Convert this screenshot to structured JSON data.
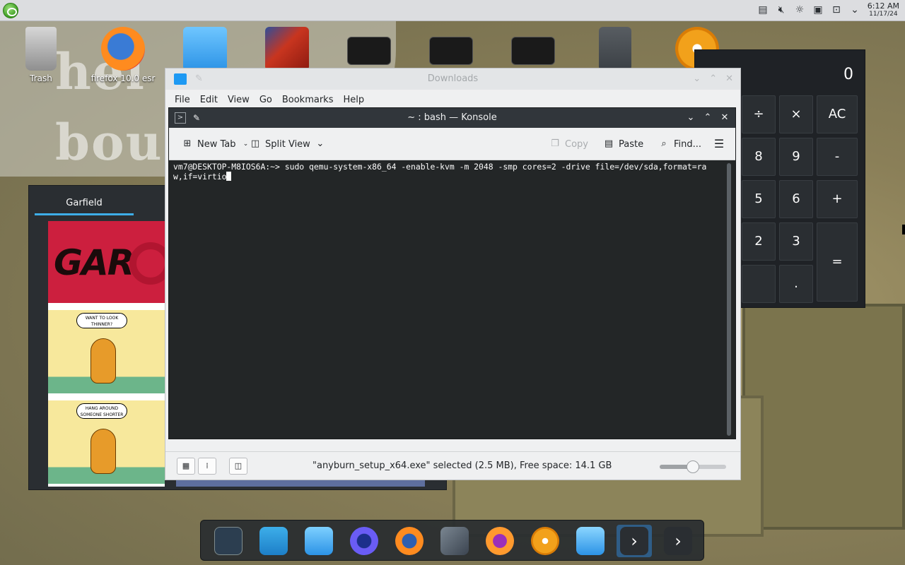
{
  "top_panel": {
    "clock_time": "6:12 AM",
    "clock_date": "11/17/24",
    "tray_icons": [
      "clipboard-icon",
      "volume-muted-icon",
      "brightness-icon",
      "storage-icon",
      "network-icon",
      "expand-tray-icon"
    ]
  },
  "desktop": {
    "icons": [
      {
        "label": "Trash",
        "icon": "trash-icon"
      },
      {
        "label": "firefox 10.0 esr",
        "icon": "firefox-icon"
      },
      {
        "label": "",
        "icon": "home-folder-icon"
      },
      {
        "label": "",
        "icon": "dinosaur-app-icon"
      },
      {
        "label": "",
        "icon": "vaio-image-icon"
      },
      {
        "label": "",
        "icon": "vaio-image-icon"
      },
      {
        "label": "",
        "icon": "vaio-image-icon"
      },
      {
        "label": "",
        "icon": "terminal-script-icon"
      },
      {
        "label": "",
        "icon": "disc-burner-icon"
      }
    ]
  },
  "garfield_window": {
    "tab_label": "Garfield",
    "comic_title": "GAR",
    "bubble1": "WANT TO LOOK THINNER?",
    "bubble2": "HANG AROUND SOMEONE SHORTER"
  },
  "downloads_window": {
    "title": "Downloads",
    "menu": [
      "File",
      "Edit",
      "View",
      "Go",
      "Bookmarks",
      "Help"
    ],
    "status_text": "\"anyburn_setup_x64.exe\" selected (2.5 MB), Free space: 14.1 GB",
    "zoom_level": 0.5
  },
  "konsole": {
    "title": "~ : bash — Konsole",
    "toolbar": {
      "new_tab": "New Tab",
      "split_view": "Split View",
      "copy": "Copy",
      "paste": "Paste",
      "find": "Find..."
    },
    "lines": [
      "vm7@DESKTOP-M8IOS6A:~> sudo qemu-system-x86_64 -enable-kvm -m 2048 -smp cores=2 -drive file=/dev/sda,format=ra",
      "w,if=virtio"
    ]
  },
  "calculator": {
    "display": "0",
    "buttons": [
      "÷",
      "×",
      "AC",
      "8",
      "9",
      "-",
      "5",
      "6",
      "+",
      "2",
      "3",
      "=",
      "."
    ]
  },
  "dock": {
    "items": [
      "system-settings-icon",
      "discover-store-icon",
      "file-manager-icon",
      "firefox-nightly-icon",
      "firefox-icon",
      "text-editor-icon",
      "firefox-alt-icon",
      "disc-burner-icon",
      "folder-new-icon",
      "terminal-icon",
      "terminal-alt-icon"
    ]
  }
}
